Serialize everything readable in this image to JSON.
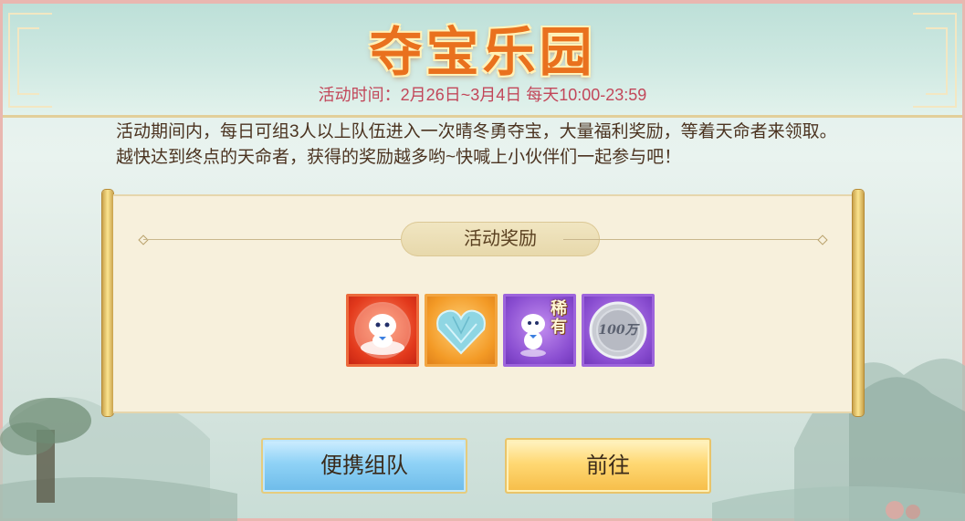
{
  "header": {
    "title": "夺宝乐园",
    "event_time": "活动时间：2月26日~3月4日 每天10:00-23:59"
  },
  "description": "活动期间内，每日可组3人以上队伍进入一次晴冬勇夺宝，大量福利奖励，等着天命者来领取。越快达到终点的天命者，获得的奖励越多哟~快喊上小伙伴们一起参与吧！",
  "rewards": {
    "heading": "活动奖励",
    "items": [
      {
        "icon": "snow-spirit-bubble-icon",
        "bg": "#e2391c"
      },
      {
        "icon": "ice-crystal-heart-icon",
        "bg": "#f39a26"
      },
      {
        "icon": "rare-snow-spirit-icon",
        "tag": "稀有",
        "bg": "#8a4ed1"
      },
      {
        "icon": "silver-coin-icon",
        "label": "100万",
        "bg": "#8a4ed1"
      }
    ]
  },
  "buttons": {
    "team_label": "便携组队",
    "go_label": "前往"
  }
}
